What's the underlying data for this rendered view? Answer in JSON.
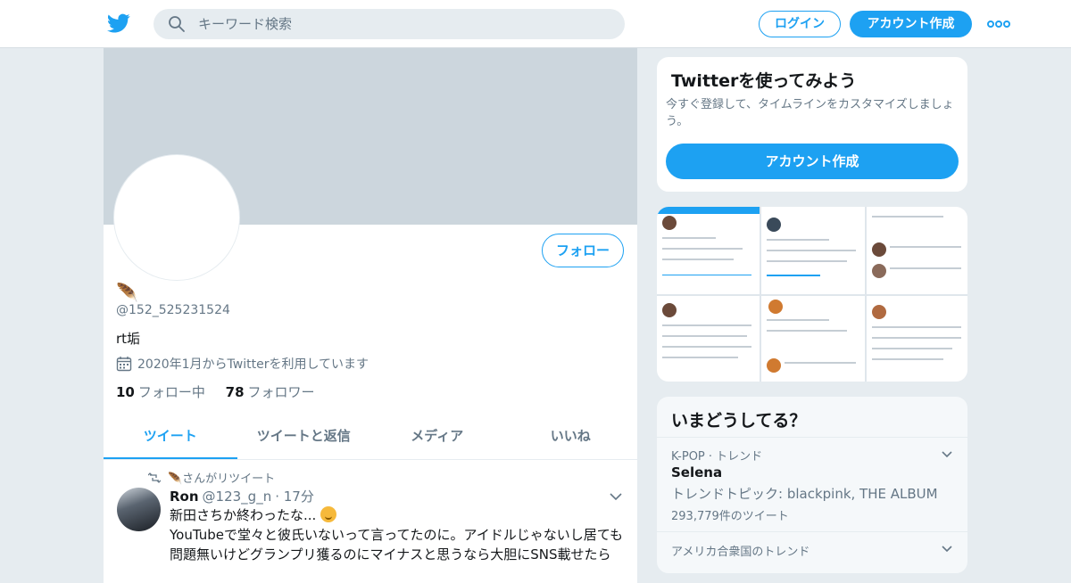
{
  "header": {
    "search_placeholder": "キーワード検索",
    "login_label": "ログイン",
    "signup_label": "アカウント作成"
  },
  "profile": {
    "display_name": "🪶",
    "handle": "@152_525231524",
    "bio": "rt垢",
    "joined": "2020年1月からTwitterを利用しています",
    "following_count": "10",
    "following_label": "フォロー中",
    "followers_count": "78",
    "followers_label": "フォロワー",
    "follow_button": "フォロー"
  },
  "tabs": [
    {
      "label": "ツイート"
    },
    {
      "label": "ツイートと返信"
    },
    {
      "label": "メディア"
    },
    {
      "label": "いいね"
    }
  ],
  "tweet": {
    "retweet_note": "🪶さんがリツイート",
    "name": "Ron",
    "handle": "@123_g_n",
    "time": "· 17分",
    "line1": "新田さちか終わったな...",
    "line2": "YouTubeで堂々と彼氏いないって言ってたのに。アイドルじゃないし居ても問題無いけどグランプリ獲るのにマイナスと思うなら大胆にSNS載せたら"
  },
  "sidebar": {
    "try_title": "Twitterを使ってみよう",
    "try_desc": "今すぐ登録して、タイムラインをカスタマイズしましょう。",
    "try_button": "アカウント作成",
    "trends_title": "いまどうしてる？",
    "trends": [
      {
        "context": "K-POP · トレンド",
        "name": "Selena",
        "desc": "トレンドトピック: blackpink, THE ALBUM",
        "count": "293,779件のツイート"
      },
      {
        "context": "アメリカ合衆国のトレンド"
      }
    ]
  },
  "colors": {
    "accent": "#1da1f2",
    "banner": "#ccd6dd",
    "muted": "#657786"
  }
}
